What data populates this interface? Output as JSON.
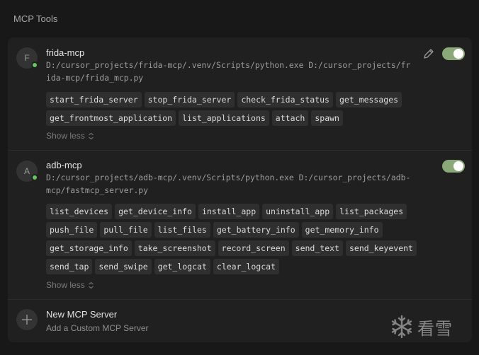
{
  "section_title": "MCP Tools",
  "servers": [
    {
      "avatar": "F",
      "name": "frida-mcp",
      "command": "D:/cursor_projects/frida-mcp/.venv/Scripts/python.exe D:/cursor_projects/frida-mcp/frida_mcp.py",
      "enabled": true,
      "status_color": "#67c45e",
      "tools": [
        "start_frida_server",
        "stop_frida_server",
        "check_frida_status",
        "get_messages",
        "get_frontmost_application",
        "list_applications",
        "attach",
        "spawn"
      ],
      "show_less": "Show less"
    },
    {
      "avatar": "A",
      "name": "adb-mcp",
      "command": "D:/cursor_projects/adb-mcp/.venv/Scripts/python.exe D:/cursor_projects/adb-mcp/fastmcp_server.py",
      "enabled": true,
      "status_color": "#67c45e",
      "tools": [
        "list_devices",
        "get_device_info",
        "install_app",
        "uninstall_app",
        "list_packages",
        "push_file",
        "pull_file",
        "list_files",
        "get_battery_info",
        "get_memory_info",
        "get_storage_info",
        "take_screenshot",
        "record_screen",
        "send_text",
        "send_keyevent",
        "send_tap",
        "send_swipe",
        "get_logcat",
        "clear_logcat"
      ],
      "show_less": "Show less"
    }
  ],
  "new_server": {
    "title": "New MCP Server",
    "subtitle": "Add a Custom MCP Server"
  },
  "watermark": {
    "text": "看雪",
    "icon": "snowflake-icon"
  },
  "colors": {
    "toggle_on": "#8aa878",
    "status_online": "#67c45e"
  }
}
